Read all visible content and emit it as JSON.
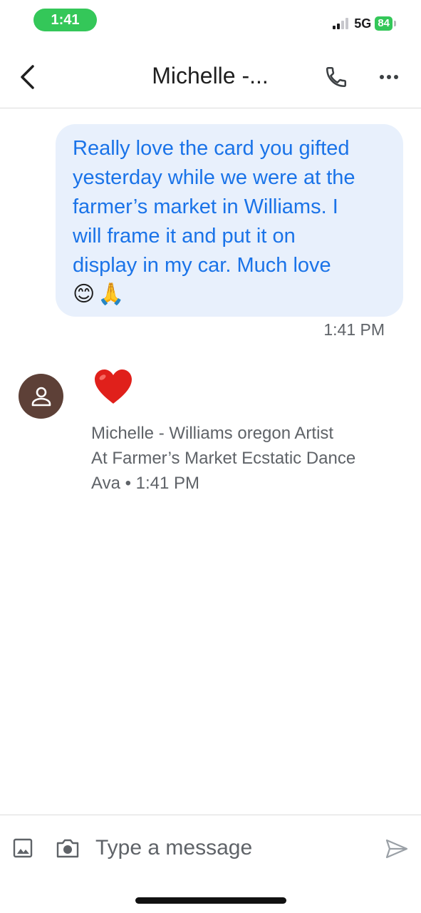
{
  "status_bar": {
    "time": "1:41",
    "network": "5G",
    "battery": "84"
  },
  "header": {
    "title": "Michelle -..."
  },
  "outgoing_message": {
    "lines": [
      "Really love the card you gifted",
      "yesterday while we were at the",
      "farmer’s market in Williams. I",
      "will frame it and put it on",
      "display in my car. Much love"
    ],
    "emojis": [
      "😊",
      "🙏"
    ],
    "time": "1:41 PM"
  },
  "incoming_message": {
    "reaction": "❤️",
    "sender_lines": [
      "Michelle - Williams oregon Artist",
      "At Farmer’s Market Ecstatic Dance",
      "Ava • 1:41 PM"
    ]
  },
  "composer": {
    "placeholder": "Type a message"
  },
  "icons": {
    "back": "back-arrow-icon",
    "call": "phone-icon",
    "more": "more-horizontal-icon",
    "avatar": "person-icon",
    "gallery": "image-icon",
    "camera": "camera-icon",
    "send": "send-icon"
  },
  "colors": {
    "bubble_bg": "#e8f0fc",
    "bubble_text": "#1a73e8",
    "avatar_bg": "#5d4037",
    "status_green": "#34c759"
  }
}
